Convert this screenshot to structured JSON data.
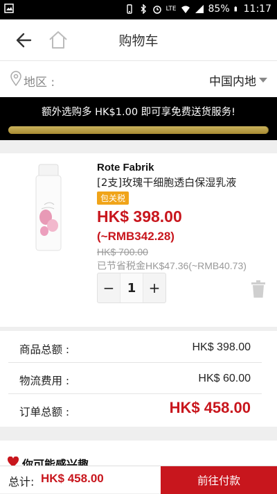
{
  "status_bar": {
    "battery": "85%",
    "time": "11:17",
    "network": "LTE"
  },
  "header": {
    "title": "购物车"
  },
  "region": {
    "label": "地区 :",
    "value": "中国内地"
  },
  "promo": {
    "text": "额外选购多 HK$1.00 即可享免费送货服务!",
    "progress_fraction": 0.997
  },
  "product": {
    "brand": "Rote Fabrik",
    "name": "[2支]玫瑰干细胞透白保湿乳液",
    "badge": "包关税",
    "price": "HK$ 398.00",
    "rmb_price": "(~RMB342.28)",
    "original_price": "HK$ 700.00",
    "tax_saved": "已节省税金HK$47.36(~RMB40.73)",
    "quantity": "1",
    "minus": "−",
    "plus": "+"
  },
  "summary": {
    "subtotal_label": "商品总额 :",
    "subtotal_value": "HK$ 398.00",
    "shipping_label": "物流费用 :",
    "shipping_value": "HK$ 60.00",
    "total_label": "订单总额 :",
    "total_value": "HK$ 458.00"
  },
  "recommendations": {
    "title": "你可能感兴趣"
  },
  "bottom_bar": {
    "total_label": "总计:",
    "total_value": "HK$ 458.00",
    "checkout_label": "前往付款"
  },
  "colors": {
    "accent": "#c8161d",
    "badge": "#f0a419",
    "promo_bg": "#000000",
    "progress": "#b8a04a"
  }
}
